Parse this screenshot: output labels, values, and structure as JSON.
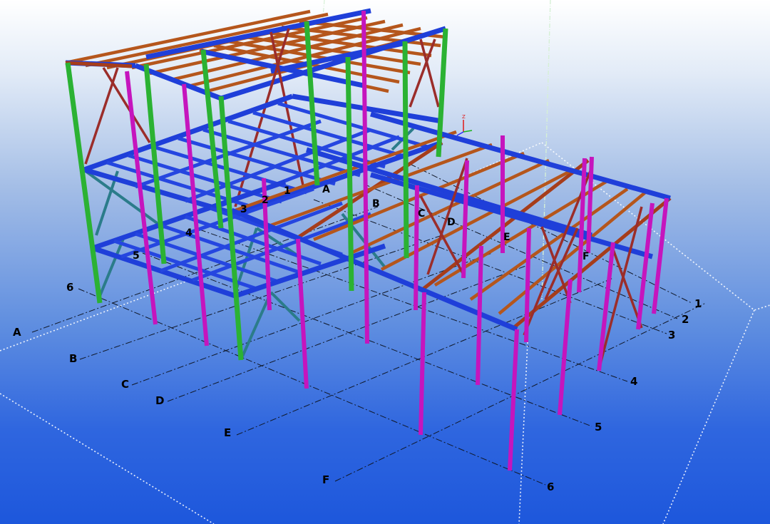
{
  "viewport": {
    "description_name": "3D structural model view"
  },
  "grid_labels": {
    "letters": [
      "A",
      "B",
      "C",
      "D",
      "E",
      "F"
    ],
    "numbers": [
      "1",
      "2",
      "3",
      "4",
      "5",
      "6"
    ],
    "upper_letters": [
      "A",
      "B",
      "C",
      "D",
      "E",
      "F"
    ],
    "upper_numbers": [
      "1",
      "2",
      "3",
      "4",
      "5",
      "6"
    ]
  },
  "axis_triad": {
    "z_label": "Z",
    "x_label": "X",
    "y_label": "Y"
  },
  "colors": {
    "columns_green": "#2bb233",
    "columns_magenta": "#c515bd",
    "beams_blue": "#1f3fd9",
    "purlins_orange": "#b5561c",
    "bracing_red": "#9b2d2a",
    "bracing_teal": "#2b7c8a"
  }
}
